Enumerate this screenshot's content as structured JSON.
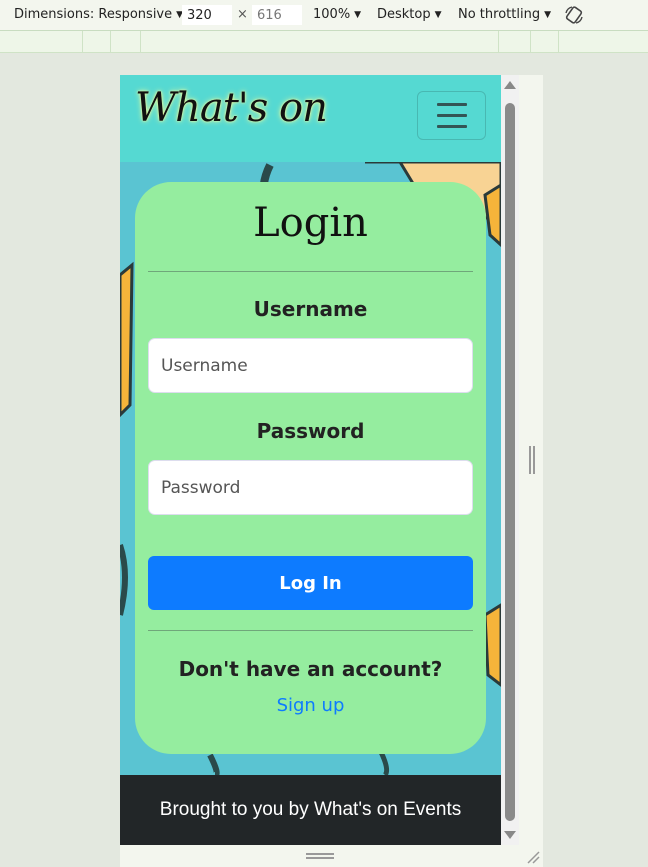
{
  "toolbar": {
    "dimensions_label": "Dimensions: Responsive",
    "width_value": "320",
    "times": "×",
    "height_value": "616",
    "zoom": "100%",
    "device_type": "Desktop",
    "throttling": "No throttling",
    "rotate_icon": "rotate-icon"
  },
  "navbar": {
    "brand": "What's on",
    "toggler_icon": "hamburger-icon"
  },
  "login": {
    "title": "Login",
    "username_label": "Username",
    "username_placeholder": "Username",
    "password_label": "Password",
    "password_placeholder": "Password",
    "submit_label": "Log In",
    "no_account_text": "Don't have an account?",
    "signup_link": "Sign up"
  },
  "footer": {
    "text": "Brought to you by What's on Events"
  },
  "colors": {
    "navbar_bg": "#55d9d2",
    "card_bg": "#95ed9f",
    "primary_button": "#0d7bff",
    "footer_bg": "#222628"
  }
}
